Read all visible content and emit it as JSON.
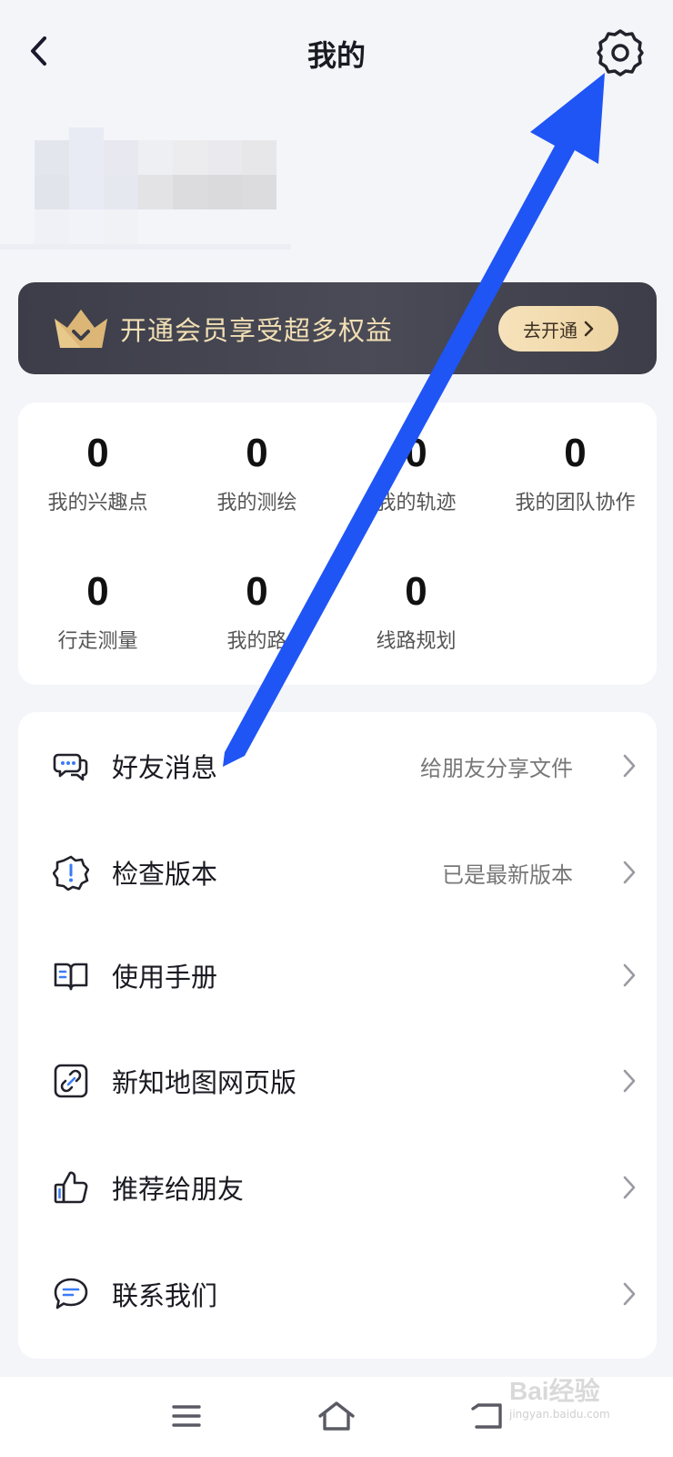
{
  "header": {
    "title": "我的"
  },
  "vip_banner": {
    "text": "开通会员享受超多权益",
    "button_label": "去开通"
  },
  "stats": [
    {
      "value": "0",
      "label": "我的兴趣点"
    },
    {
      "value": "0",
      "label": "我的测绘"
    },
    {
      "value": "0",
      "label": "我的轨迹"
    },
    {
      "value": "0",
      "label": "我的团队协作"
    },
    {
      "value": "0",
      "label": "行走测量"
    },
    {
      "value": "0",
      "label": "我的路"
    },
    {
      "value": "0",
      "label": "线路规划"
    }
  ],
  "menu": [
    {
      "label": "好友消息",
      "value": "给朋友分享文件",
      "icon": "chat-bubbles-icon"
    },
    {
      "label": "检查版本",
      "value": "已是最新版本",
      "icon": "version-badge-icon"
    },
    {
      "label": "使用手册",
      "value": "",
      "icon": "book-icon"
    },
    {
      "label": "新知地图网页版",
      "value": "",
      "icon": "link-icon"
    },
    {
      "label": "推荐给朋友",
      "value": "",
      "icon": "thumbs-up-icon"
    },
    {
      "label": "联系我们",
      "value": "",
      "icon": "message-icon"
    }
  ],
  "watermark": {
    "logo": "Bai经验",
    "sub": "jingyan.baidu.com"
  },
  "colors": {
    "page_bg": "#f4f5f9",
    "vip_text": "#f2dfb4",
    "vip_button": "#f2dbb0",
    "annotation_arrow": "#1f55f5",
    "icon_accent": "#3a7bf6"
  }
}
